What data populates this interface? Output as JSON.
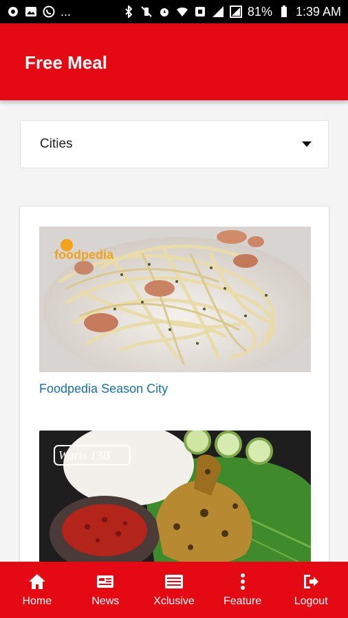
{
  "status_bar": {
    "battery": "81%",
    "time": "1:39 AM",
    "more": "..."
  },
  "app_bar": {
    "title": "Free Meal"
  },
  "city_select": {
    "selected": "Cities"
  },
  "restaurants": [
    {
      "name": "Foodpedia Season City",
      "image_logo": "foodpedia"
    },
    {
      "name": "",
      "image_logo": "Waris 13B"
    }
  ],
  "bottom_nav": [
    {
      "label": "Home",
      "icon": "home-icon"
    },
    {
      "label": "News",
      "icon": "news-icon"
    },
    {
      "label": "Xclusive",
      "icon": "xclusive-icon"
    },
    {
      "label": "Feature",
      "icon": "more-vertical-icon"
    },
    {
      "label": "Logout",
      "icon": "logout-icon"
    }
  ],
  "colors": {
    "primary": "#e50914",
    "link": "#1a6fa8",
    "background": "#f4f4f4"
  }
}
